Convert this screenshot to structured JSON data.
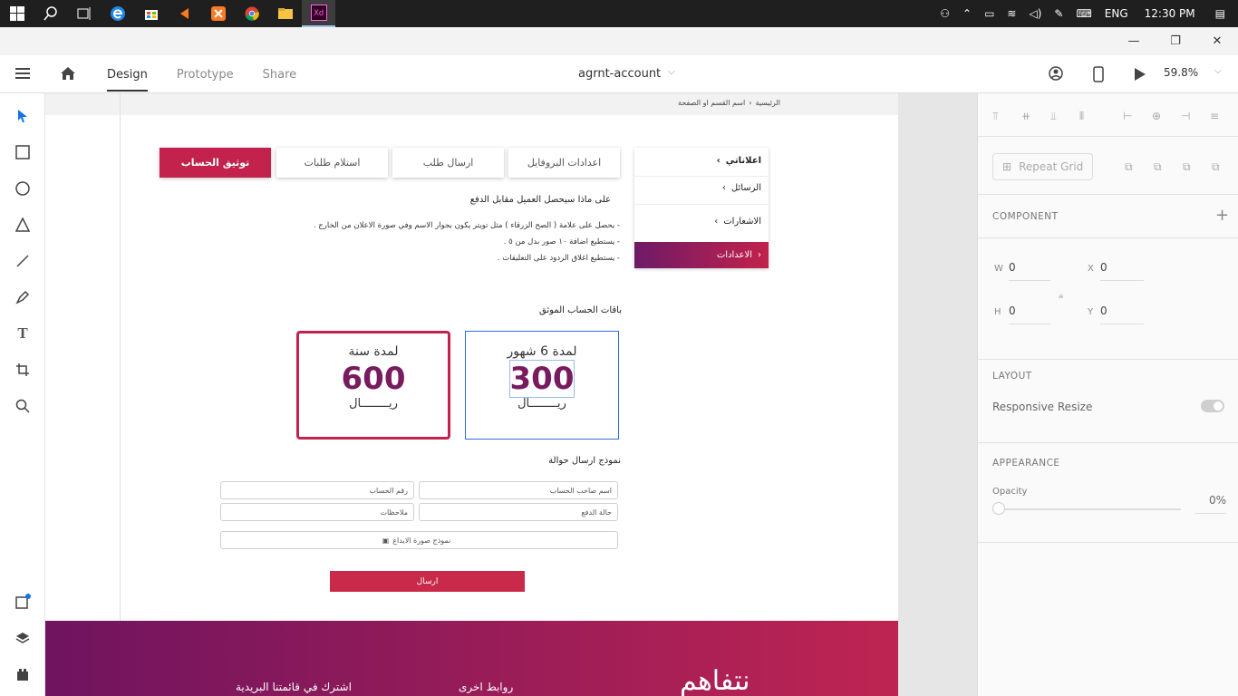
{
  "taskbar": {
    "apps": [
      "start-icon",
      "search-icon",
      "task-view-icon",
      "edge-icon",
      "store-icon",
      "media-icon",
      "xampp-icon",
      "chrome-icon",
      "explorer-icon",
      "xd-icon"
    ],
    "active_app": "Xd",
    "language": "ENG",
    "time": "12:30 PM"
  },
  "appbar": {
    "tabs": [
      "Design",
      "Prototype",
      "Share"
    ],
    "active_tab": "Design",
    "document_title": "agrnt-account",
    "zoom": "59.8%"
  },
  "artboard": {
    "breadcrumb_home": "الرئيسية",
    "breadcrumb_page": "اسم القسم او الصفحة",
    "tabs": [
      "توثيق الحساب",
      "استلام طلبات",
      "ارسال طلب",
      "اعدادات البروفايل"
    ],
    "side_menu": [
      "اعلاناتي",
      "الرسائل",
      "الاشعارات",
      "الاعدادات"
    ],
    "heading_benefits": "على ماذا سيحصل العميل مقابل الدفع",
    "benefits": [
      "- يحصل على علامة ( الصح الزرقاء ) مثل تويتر يكون بجوار الاسم وفي صورة الاعلان من الخارج .",
      "- يستطيع اضافة ١٠ صور بدل من ٥ .",
      "- يستطيع اغلاق الردود على التعليقات ."
    ],
    "packages_title": "باقات الحساب الموثق",
    "packages": [
      {
        "period": "لمدة 6 شهور",
        "price": "300",
        "unit": "ريــــــــال"
      },
      {
        "period": "لمدة سنة",
        "price": "600",
        "unit": "ريــــــــال"
      }
    ],
    "transfer_title": "نموذج ارسال حوالة",
    "fields": {
      "account_holder": "اسم صاحب الحساب",
      "account_number": "رقم الحساب",
      "payment_status": "حالة الدفع",
      "notes": "ملاحظات",
      "deposit_image": "نموذج صورة الايداع"
    },
    "submit_label": "ارسال",
    "footer": {
      "logo": "نتفاهم",
      "links_title": "روابط اخرى",
      "newsletter_title": "اشترك في قائمتنا البريدية"
    }
  },
  "right_panel": {
    "repeat_grid": "Repeat Grid",
    "component": "COMPONENT",
    "w_label": "W",
    "w_value": "0",
    "x_label": "X",
    "x_value": "0",
    "h_label": "H",
    "h_value": "0",
    "y_label": "Y",
    "y_value": "0",
    "layout": "LAYOUT",
    "responsive_resize": "Responsive Resize",
    "appearance": "APPEARANCE",
    "opacity_label": "Opacity",
    "opacity_value": "0%"
  },
  "colors": {
    "accent": "#c2224b",
    "purple": "#7a1a5f",
    "selection_blue": "#2b6fd6"
  }
}
